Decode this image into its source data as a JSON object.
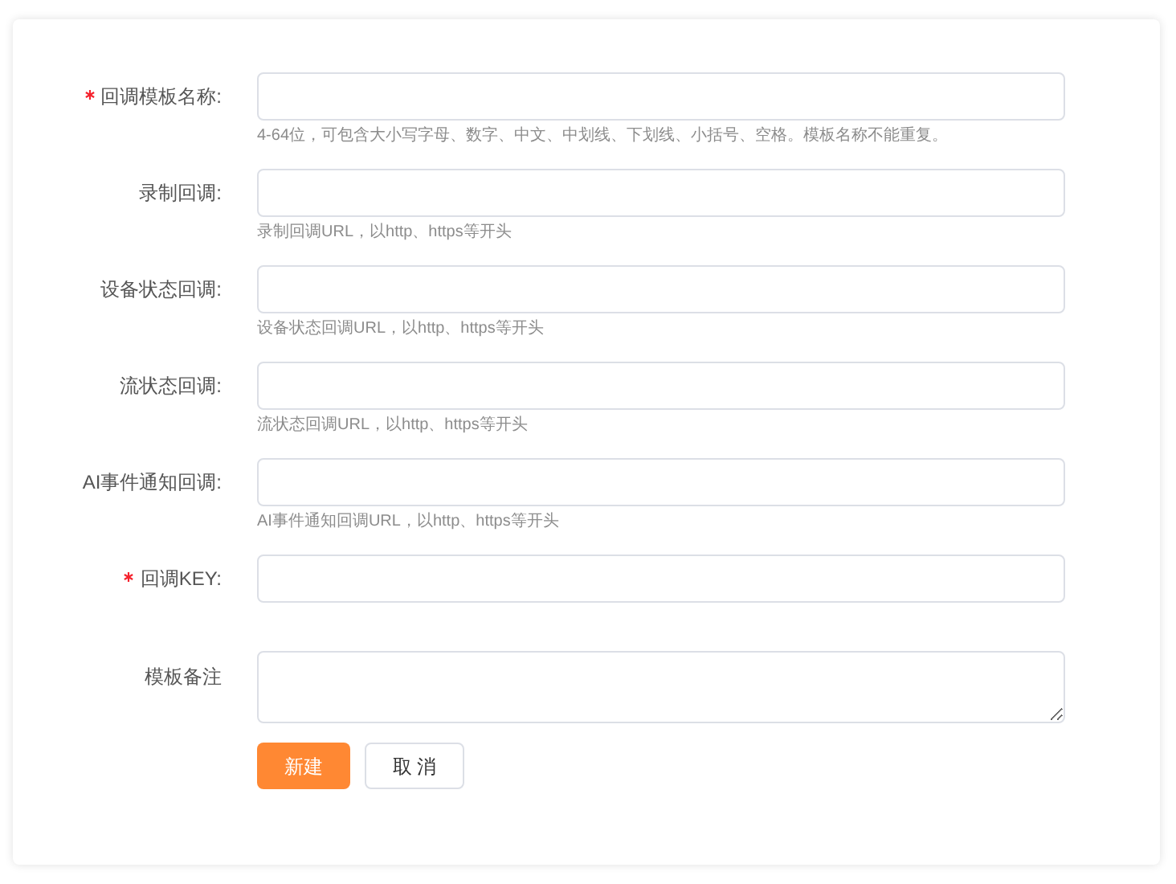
{
  "fields": [
    {
      "kind": "input",
      "label": "回调模板名称:",
      "required": true,
      "hint": "4-64位，可包含大小写字母、数字、中文、中划线、下划线、小括号、空格。模板名称不能重复。"
    },
    {
      "kind": "input",
      "label": "录制回调:",
      "required": false,
      "hint": "录制回调URL，以http、https等开头"
    },
    {
      "kind": "input",
      "label": "设备状态回调:",
      "required": false,
      "hint": "设备状态回调URL，以http、https等开头"
    },
    {
      "kind": "input",
      "label": "流状态回调:",
      "required": false,
      "hint": "流状态回调URL，以http、https等开头"
    },
    {
      "kind": "input",
      "label": "AI事件通知回调:",
      "required": false,
      "hint": "AI事件通知回调URL，以http、https等开头"
    },
    {
      "kind": "input",
      "label": "回调KEY:",
      "required": true
    },
    {
      "kind": "textarea",
      "label": "模板备注",
      "required": false
    }
  ],
  "buttons": [
    {
      "label": "新建",
      "kind": "primary"
    },
    {
      "label": "取 消",
      "kind": "default"
    }
  ]
}
